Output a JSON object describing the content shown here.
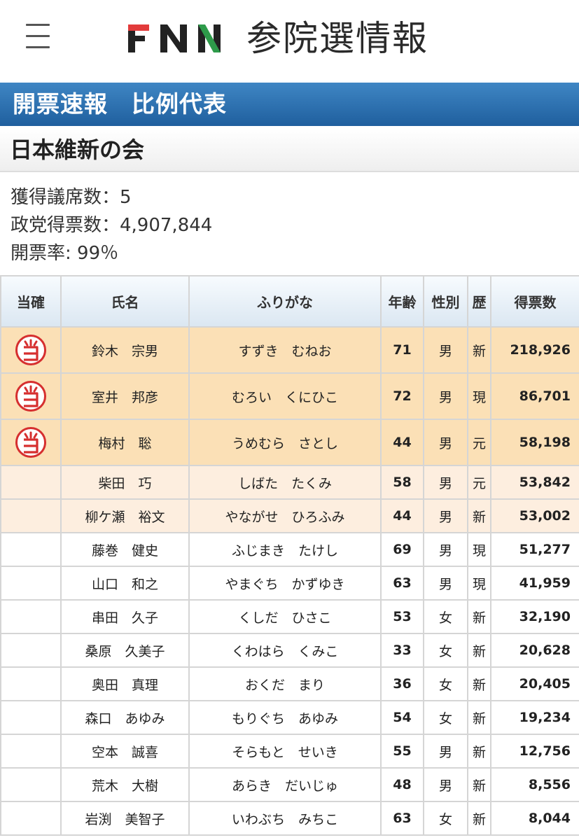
{
  "header": {
    "logo_text": "FNN",
    "site_title": "参院選情報"
  },
  "banner": {
    "left": "開票速報",
    "right": "比例代表"
  },
  "party": {
    "name": "日本維新の会"
  },
  "stats": {
    "seats": "獲得議席数：5",
    "votes": "政党得票数：4,907,844",
    "rate": "開票率: 99％"
  },
  "table": {
    "headers": [
      "当確",
      "氏名",
      "ふりがな",
      "年齢",
      "性別",
      "歴",
      "得票数"
    ],
    "rows": [
      {
        "name": "鈴木　宗男",
        "kana": "すずき　むねお",
        "age": "71",
        "sex": "男",
        "hist": "新",
        "votes": "218,926",
        "elected": true
      },
      {
        "name": "室井　邦彦",
        "kana": "むろい　くにひこ",
        "age": "72",
        "sex": "男",
        "hist": "現",
        "votes": "86,701",
        "elected": true
      },
      {
        "name": "梅村　聡",
        "kana": "うめむら　さとし",
        "age": "44",
        "sex": "男",
        "hist": "元",
        "votes": "58,198",
        "elected": true
      },
      {
        "name": "柴田　巧",
        "kana": "しばた　たくみ",
        "age": "58",
        "sex": "男",
        "hist": "元",
        "votes": "53,842",
        "elected": false
      },
      {
        "name": "柳ケ瀬　裕文",
        "kana": "やながせ　ひろふみ",
        "age": "44",
        "sex": "男",
        "hist": "新",
        "votes": "53,002",
        "elected": false
      },
      {
        "name": "藤巻　健史",
        "kana": "ふじまき　たけし",
        "age": "69",
        "sex": "男",
        "hist": "現",
        "votes": "51,277",
        "elected": false
      },
      {
        "name": "山口　和之",
        "kana": "やまぐち　かずゆき",
        "age": "63",
        "sex": "男",
        "hist": "現",
        "votes": "41,959",
        "elected": false
      },
      {
        "name": "串田　久子",
        "kana": "くしだ　ひさこ",
        "age": "53",
        "sex": "女",
        "hist": "新",
        "votes": "32,190",
        "elected": false
      },
      {
        "name": "桑原　久美子",
        "kana": "くわはら　くみこ",
        "age": "33",
        "sex": "女",
        "hist": "新",
        "votes": "20,628",
        "elected": false
      },
      {
        "name": "奥田　真理",
        "kana": "おくだ　まり",
        "age": "36",
        "sex": "女",
        "hist": "新",
        "votes": "20,405",
        "elected": false
      },
      {
        "name": "森口　あゆみ",
        "kana": "もりぐち　あゆみ",
        "age": "54",
        "sex": "女",
        "hist": "新",
        "votes": "19,234",
        "elected": false
      },
      {
        "name": "空本　誠喜",
        "kana": "そらもと　せいき",
        "age": "55",
        "sex": "男",
        "hist": "新",
        "votes": "12,756",
        "elected": false
      },
      {
        "name": "荒木　大樹",
        "kana": "あらき　だいじゅ",
        "age": "48",
        "sex": "男",
        "hist": "新",
        "votes": "8,556",
        "elected": false
      },
      {
        "name": "岩渕　美智子",
        "kana": "いわぶち　みちこ",
        "age": "63",
        "sex": "女",
        "hist": "新",
        "votes": "8,044",
        "elected": false
      }
    ]
  },
  "colors": {
    "banner": "#2a6db0",
    "elected_row": "#fbe0b6",
    "runner_row": "#fdeedf",
    "stamp": "#d62f2f"
  }
}
